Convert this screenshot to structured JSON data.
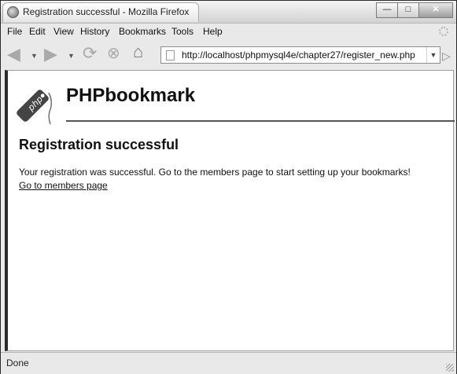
{
  "window": {
    "title": "Registration successful - Mozilla Firefox"
  },
  "menu": {
    "items": [
      {
        "label": "File"
      },
      {
        "label": "Edit"
      },
      {
        "label": "View"
      },
      {
        "label": "History"
      },
      {
        "label": "Bookmarks"
      },
      {
        "label": "Tools"
      },
      {
        "label": "Help"
      }
    ]
  },
  "address": {
    "url": "http://localhost/phpmysql4e/chapter27/register_new.php"
  },
  "page": {
    "logo_text": "php",
    "site_title": "PHPbookmark",
    "heading": "Registration successful",
    "message": "Your registration was successful. Go to the members page to start setting up your bookmarks!",
    "link": "Go to members page"
  },
  "status": {
    "text": "Done"
  },
  "icons": {
    "app": "firefox-icon",
    "back": "back-arrow-icon",
    "forward": "forward-arrow-icon",
    "reload": "reload-icon",
    "stop": "stop-icon",
    "home": "home-icon",
    "page": "page-icon",
    "go": "go-arrow-icon",
    "throbber": "throbber-icon",
    "logo": "php-tag-icon"
  }
}
